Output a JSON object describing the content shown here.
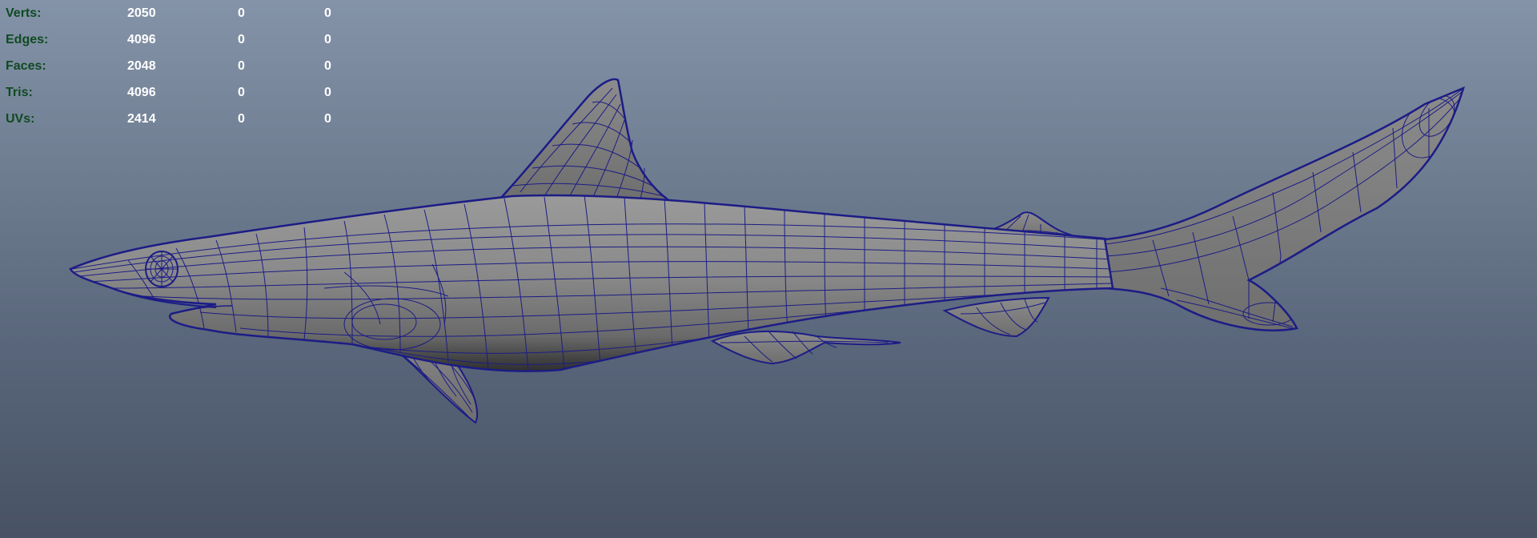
{
  "viewport": {
    "background_top": "#8493a8",
    "background_bottom": "#485264",
    "mesh_fill": "#7f7f7f",
    "wire_color": "#1c1c86",
    "model": "shark-mesh"
  },
  "hud": {
    "rows": [
      {
        "label": "Verts:",
        "total": "2050",
        "selected": "0",
        "other": "0"
      },
      {
        "label": "Edges:",
        "total": "4096",
        "selected": "0",
        "other": "0"
      },
      {
        "label": "Faces:",
        "total": "2048",
        "selected": "0",
        "other": "0"
      },
      {
        "label": "Tris:",
        "total": "4096",
        "selected": "0",
        "other": "0"
      },
      {
        "label": "UVs:",
        "total": "2414",
        "selected": "0",
        "other": "0"
      }
    ]
  }
}
